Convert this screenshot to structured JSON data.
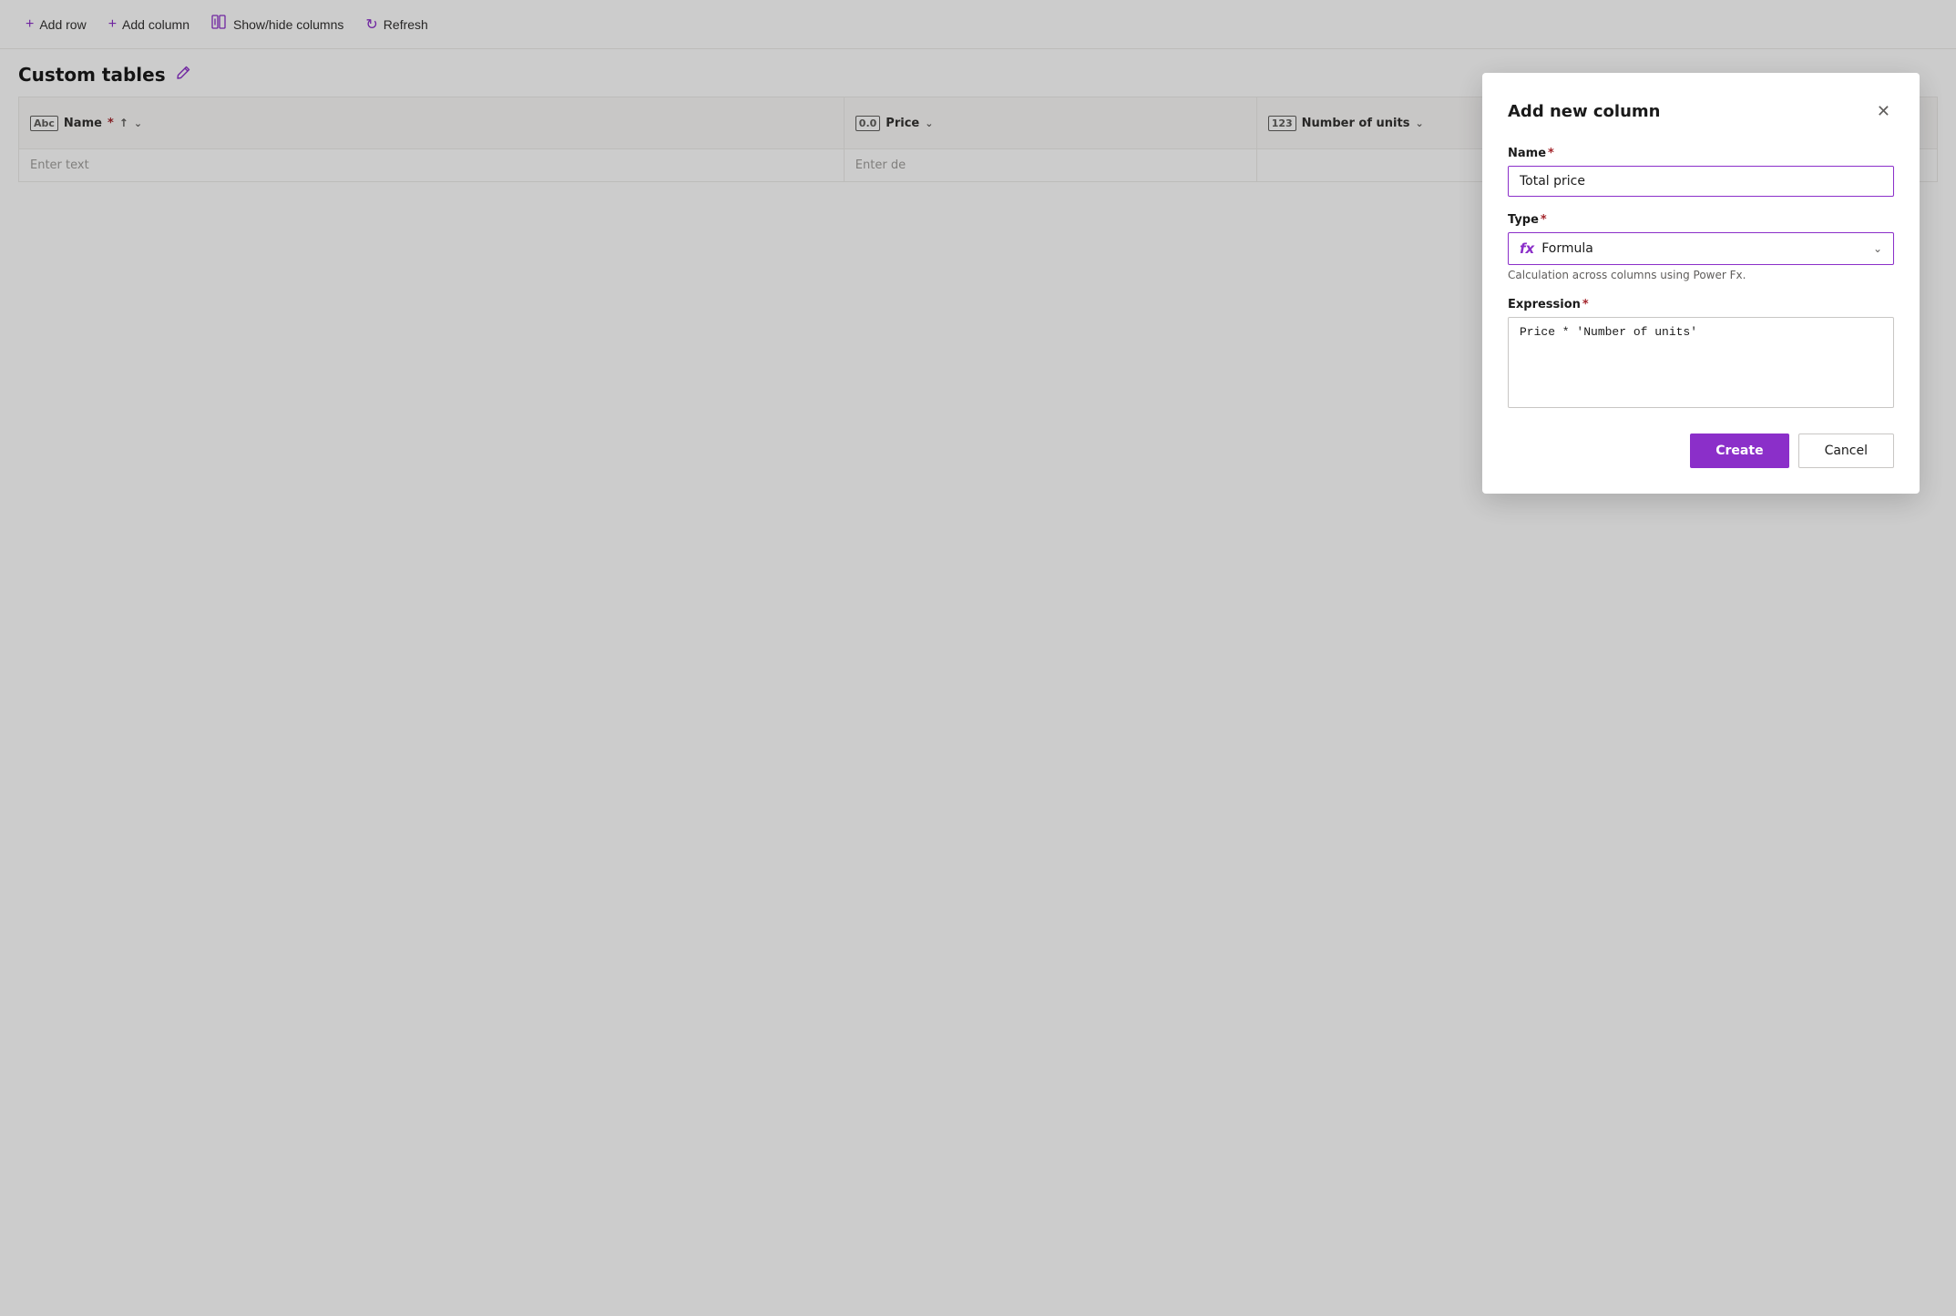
{
  "toolbar": {
    "add_row_label": "Add row",
    "add_column_label": "Add column",
    "show_hide_label": "Show/hide columns",
    "refresh_label": "Refresh"
  },
  "page": {
    "title": "Custom tables",
    "edit_tooltip": "Edit"
  },
  "table": {
    "columns": [
      {
        "id": "name",
        "icon": "Abc",
        "label": "Name",
        "required": true,
        "sortable": true,
        "has_chevron": true
      },
      {
        "id": "price",
        "icon": "0.0",
        "label": "Price",
        "required": false,
        "sortable": false,
        "has_chevron": true
      },
      {
        "id": "units",
        "icon": "123",
        "label": "Number of units",
        "required": false,
        "sortable": false,
        "has_chevron": true
      }
    ],
    "placeholder_name": "Enter text",
    "placeholder_price": "Enter de",
    "add_column_icon": "+"
  },
  "modal": {
    "title": "Add new column",
    "name_label": "Name",
    "name_placeholder": "Total price",
    "name_value": "Total price",
    "type_label": "Type",
    "type_value": "Formula",
    "type_icon": "fx",
    "helper_text": "Calculation across columns using Power Fx.",
    "expression_label": "Expression",
    "expression_value": "Price * 'Number of units'",
    "create_button": "Create",
    "cancel_button": "Cancel"
  }
}
